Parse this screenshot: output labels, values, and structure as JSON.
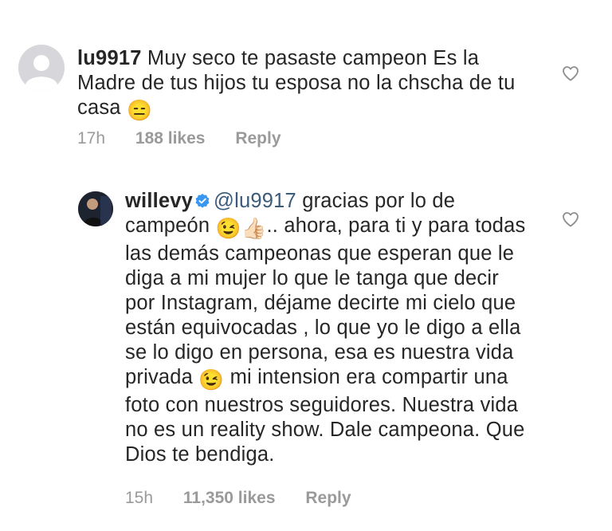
{
  "top_fragment": {
    "left": "",
    "right": ""
  },
  "comments": [
    {
      "username": "lu9917",
      "text": "Muy seco te pasaste campeon Es la Madre de tus hijos tu esposa no la chscha de tu casa",
      "emoji_end": "😑",
      "time": "17h",
      "likes": "188 likes",
      "reply": "Reply"
    },
    {
      "username": "willevy",
      "verified": true,
      "mention": "@lu9917",
      "text_1": "gracias por lo de",
      "text_2": "campeón",
      "emoji_1": "😉",
      "emoji_2": "👍🏻",
      "text_3": ".. ahora, para ti y para todas las demás campeonas que esperan que le diga a mi mujer lo que le tanga que decir por Instagram, déjame decirte mi cielo que están equivocadas , lo que yo le digo a ella se lo digo en persona, esa es nuestra vida privada",
      "emoji_3": "😉",
      "text_4": "mi intension era compartir una foto con nuestros seguidores. Nuestra vida no es un reality show. Dale campeona. Que Dios te bendiga.",
      "time": "15h",
      "likes": "11,350 likes",
      "reply": "Reply"
    }
  ],
  "icons": {
    "heart": "heart-outline-icon",
    "verified": "verified-badge-icon",
    "avatar_default": "default-avatar-icon"
  },
  "colors": {
    "text": "#262626",
    "meta": "#9a9a9a",
    "mention": "#3b5b7b",
    "verified": "#3897f0"
  }
}
